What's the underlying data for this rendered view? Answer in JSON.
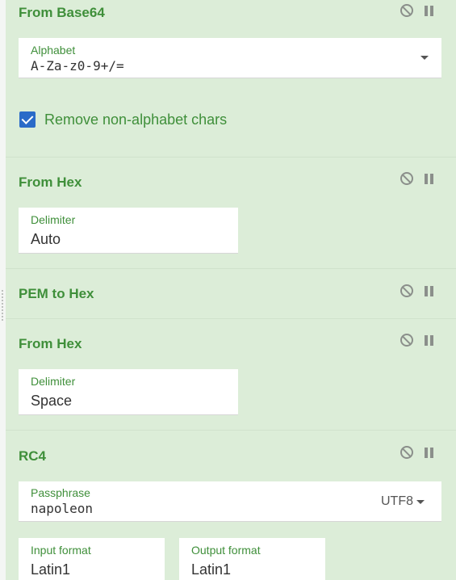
{
  "operations": [
    {
      "title": "From Base64",
      "fields": [
        {
          "label": "Alphabet",
          "value": "A-Za-z0-9+/="
        }
      ],
      "checkbox": {
        "label": "Remove non-alphabet chars",
        "checked": true
      }
    },
    {
      "title": "From Hex",
      "fields": [
        {
          "label": "Delimiter",
          "value": "Auto"
        }
      ]
    },
    {
      "title": "PEM to Hex"
    },
    {
      "title": "From Hex",
      "fields": [
        {
          "label": "Delimiter",
          "value": "Space"
        }
      ]
    },
    {
      "title": "RC4",
      "fields": [
        {
          "label": "Passphrase",
          "value": "napoleon",
          "encoding": "UTF8"
        },
        {
          "label": "Input format",
          "value": "Latin1"
        },
        {
          "label": "Output format",
          "value": "Latin1"
        }
      ]
    }
  ],
  "colors": {
    "accent": "#3f8f3a",
    "background": "#dcedd8",
    "checkbox": "#2a6bc8"
  }
}
